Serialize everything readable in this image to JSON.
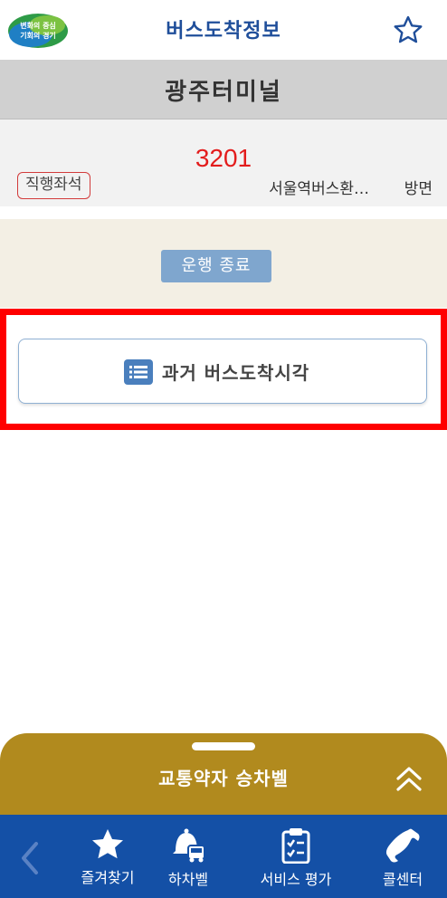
{
  "header": {
    "logo_text_line1": "변화의 중심",
    "logo_text_line2": "기회의 경기",
    "title": "버스도착정보",
    "favorite_icon": "star-outline-icon"
  },
  "station": {
    "name": "광주터미널"
  },
  "route": {
    "number": "3201",
    "type": "직행좌석",
    "destination": "서울역버스환…",
    "direction": "방면"
  },
  "status": {
    "label": "운행 종료"
  },
  "history_button": {
    "icon": "list-icon",
    "label": "과거 버스도착시각"
  },
  "bottom_sheet": {
    "title": "교통약자 승차벨",
    "expand_icon": "double-chevron-up-icon"
  },
  "bottom_nav": {
    "back_icon": "chevron-left-icon",
    "items": [
      {
        "label": "즐겨찾기",
        "icon": "star-icon"
      },
      {
        "label": "하차벨",
        "icon": "bell-bus-icon"
      },
      {
        "label": "서비스 평가",
        "icon": "clipboard-check-icon"
      },
      {
        "label": "콜센터",
        "icon": "phone-icon"
      }
    ]
  },
  "colors": {
    "brand_blue": "#1f4e9a",
    "route_red": "#e31c1c",
    "highlight_red": "#ff0000",
    "sheet_gold": "#b18a1e",
    "nav_blue": "#1450a6",
    "status_blue": "#7fa6ce"
  }
}
